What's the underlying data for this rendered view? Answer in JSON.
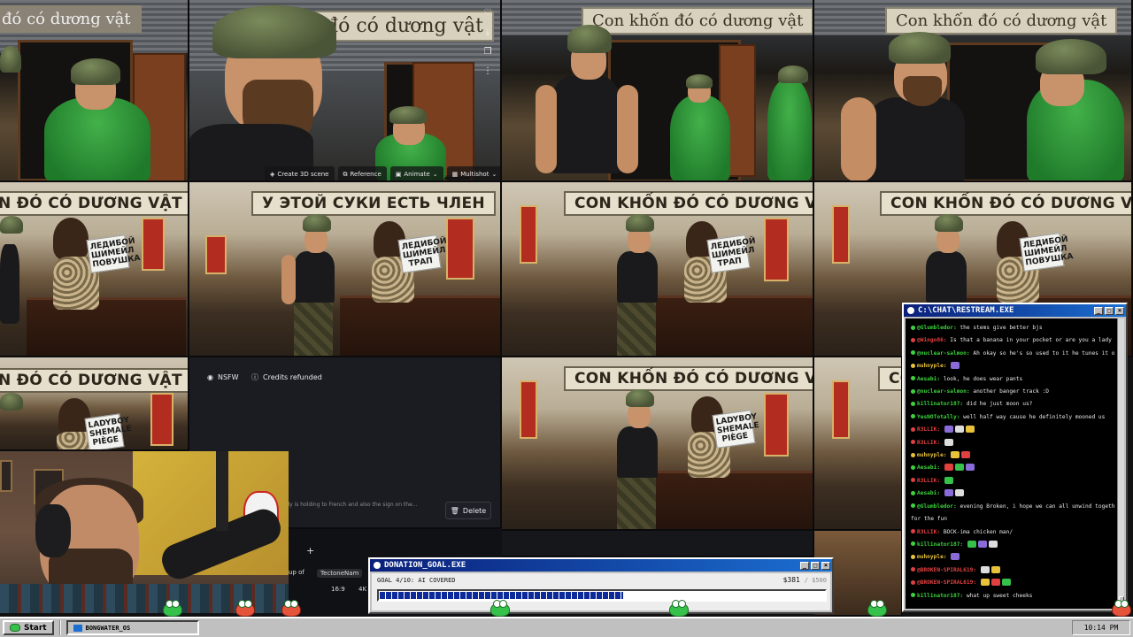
{
  "tiles": {
    "t1_sign": "đó có dương vật",
    "t2_sign": "đó có dương vật",
    "t3_sign": "Con khốn đó có dương vật",
    "t4_sign": "Con khốn đó có dương vật",
    "t5_sign": "N ĐÓ CÓ DƯƠNG VẬT",
    "t6_sign": "У ЭТОЙ СУКИ ЕСТЬ ЧЛЕН",
    "t7_sign": "CON KHỐN ĐÓ CÓ DƯƠNG VẬT",
    "t8_sign": "CON KHỐN ĐÓ CÓ DƯƠNG VẬT",
    "t9_sign": "N ĐÓ CÓ DƯƠNG VẬT",
    "t11_sign": "CON KHỐN ĐÓ CÓ DƯƠNG VẬT",
    "t12_sign": "CON",
    "paper_ru": "ЛЕДИБОЙ ШИМЕЙЛ ТРАП",
    "paper_ru2": "ЛЕДИБОЙ ШИМЕЙЛ ПОВУШКА",
    "paper_fr": "LADYBOY SHEMALE PIÈGE"
  },
  "toolbar": {
    "create3d": "Create 3D scene",
    "reference": "Reference",
    "animate": "Animate",
    "multishot": "Multishot"
  },
  "panel": {
    "nsfw": "NSFW",
    "credits": "Credits refunded",
    "caption": "lady is holding to French and also the sign on the...",
    "delete": "Delete",
    "user": "TectoneNam",
    "prefix": "up of",
    "ratio": "16:9",
    "res": "4K"
  },
  "chat": {
    "title": "C:\\CHAT\\RESTREAM.EXE",
    "lines": [
      {
        "u": "@Glumbledor",
        "c": "#3bd33b",
        "t": "the stems give better bjs"
      },
      {
        "u": "@Wingo86",
        "c": "#e04040",
        "t": "Is that a banana in your pocket or are you a lady boi?"
      },
      {
        "u": "@nuclear-salmon",
        "c": "#3bd33b",
        "t": "Ah okay so he's so used to it he tunes it out"
      },
      {
        "u": "muhnyple",
        "c": "#e8c23a",
        "t": ""
      },
      {
        "u": "Aesabi",
        "c": "#3bd33b",
        "t": "look, he does wear pants"
      },
      {
        "u": "@nuclear-salmon",
        "c": "#3bd33b",
        "t": "another banger track :D"
      },
      {
        "u": "killinator187",
        "c": "#3bd33b",
        "t": "did he just moon us?"
      },
      {
        "u": "YesNOTotally",
        "c": "#3bd33b",
        "t": "well half way cause he definitely mooned us"
      },
      {
        "u": "R3LLIK",
        "c": "#e04040",
        "t": ""
      },
      {
        "u": "R3LLIK",
        "c": "#e04040",
        "t": ""
      },
      {
        "u": "muhnyple",
        "c": "#e8c23a",
        "t": ""
      },
      {
        "u": "Aesabi",
        "c": "#3bd33b",
        "t": ""
      },
      {
        "u": "R3LLIK",
        "c": "#e04040",
        "t": ""
      },
      {
        "u": "Aesabi",
        "c": "#3bd33b",
        "t": ""
      },
      {
        "u": "@Glumbledor",
        "c": "#3bd33b",
        "t": "evening Broken, i hope we can all unwind together"
      },
      {
        "u": "",
        "c": "#e8e8e8",
        "t": "for the fun"
      },
      {
        "u": "R3LLIK",
        "c": "#e04040",
        "t": "BOCK-ima chicken man/"
      },
      {
        "u": "killinator187",
        "c": "#3bd33b",
        "t": ""
      },
      {
        "u": "muhnyple",
        "c": "#e8c23a",
        "t": ""
      },
      {
        "u": "@BROKEN-SPIRAL619",
        "c": "#e04040",
        "t": ""
      },
      {
        "u": "@BROKEN-SPIRAL619",
        "c": "#e04040",
        "t": ""
      },
      {
        "u": "killinator187",
        "c": "#3bd33b",
        "t": "what up sweet cheeks"
      }
    ]
  },
  "donation": {
    "title": "DONATION_GOAL.EXE",
    "goal_label": "GOAL 4/10: AI COVERED",
    "amount": "$381",
    "target": "/ $500",
    "progress": 0.55
  },
  "taskbar": {
    "start": "Start",
    "task": "BONGWATER_OS",
    "clock": "10:14 PM"
  },
  "colors": {
    "title_bar": "#1b6fd1",
    "progress": "#0d2a9a",
    "frog": "#36c14a"
  }
}
